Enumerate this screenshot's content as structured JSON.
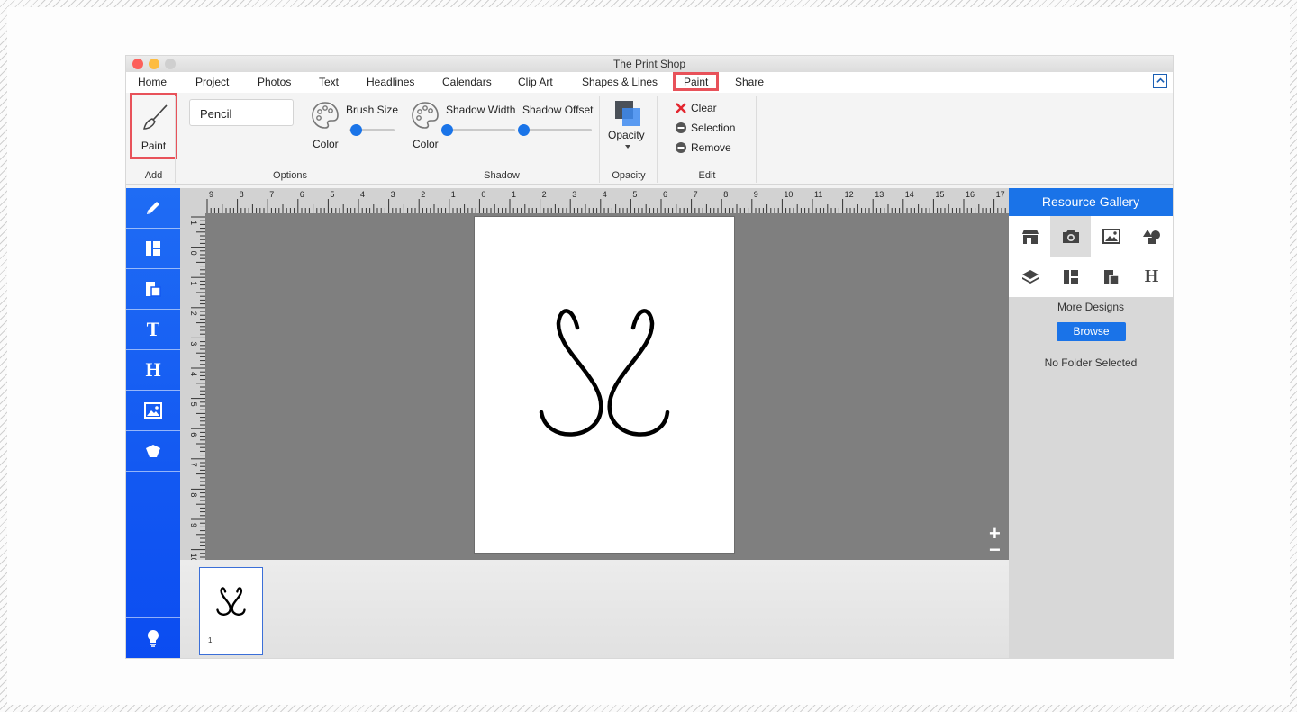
{
  "window": {
    "title": "The Print Shop"
  },
  "menu": {
    "items": [
      "Home",
      "Project",
      "Photos",
      "Text",
      "Headlines",
      "Calendars",
      "Clip Art",
      "Shapes & Lines",
      "Paint",
      "Share"
    ],
    "active": "Paint"
  },
  "ribbon": {
    "add": {
      "paint_label": "Paint",
      "group_label": "Add"
    },
    "options": {
      "brush_value": "Pencil",
      "color_label": "Color",
      "brush_size_label": "Brush Size",
      "brush_size_level": 0.2,
      "group_label": "Options"
    },
    "shadow": {
      "color_label": "Color",
      "width_label": "Shadow Width",
      "offset_label": "Shadow Offset",
      "width_level": 0.0,
      "offset_level": 0.0,
      "group_label": "Shadow"
    },
    "opacity": {
      "label": "Opacity",
      "group_label": "Opacity"
    },
    "edit": {
      "clear_label": "Clear",
      "selection_label": "Selection",
      "remove_label": "Remove",
      "group_label": "Edit"
    }
  },
  "left_toolbar": {
    "icons": [
      "pencil-icon",
      "layout-icon",
      "design-icon",
      "text-icon",
      "headline-icon",
      "photo-icon",
      "shapes-icon",
      "lightbulb-icon"
    ],
    "text_letter": "T",
    "headline_letter": "H"
  },
  "ruler": {
    "horizontal": [
      "9",
      "8",
      "7",
      "6",
      "5",
      "4",
      "3",
      "2",
      "1",
      "0",
      "1",
      "2",
      "3",
      "4",
      "5",
      "6",
      "7",
      "8",
      "9",
      "10",
      "11",
      "12",
      "13",
      "14",
      "15",
      "16",
      "17"
    ],
    "vertical": [
      "1",
      "0",
      "1",
      "2",
      "3",
      "4",
      "5",
      "6",
      "7",
      "8",
      "9",
      "10",
      "11"
    ]
  },
  "zoom": {
    "in_label": "+",
    "out_label": "−"
  },
  "thumbnail": {
    "page_number": "1"
  },
  "gallery": {
    "title": "Resource Gallery",
    "icons": [
      "store-icon",
      "camera-icon",
      "image-icon",
      "shapes-icon",
      "layers-icon",
      "layout-icon",
      "design-icon",
      "headline-icon"
    ],
    "headline_letter": "H",
    "more_designs": "More Designs",
    "browse_label": "Browse",
    "folder_status": "No Folder Selected"
  },
  "colors": {
    "accent": "#1a73e8",
    "toolbar_blue": "#0b4cf1",
    "highlight": "#e8525a",
    "canvas": "#7f7f7f"
  }
}
